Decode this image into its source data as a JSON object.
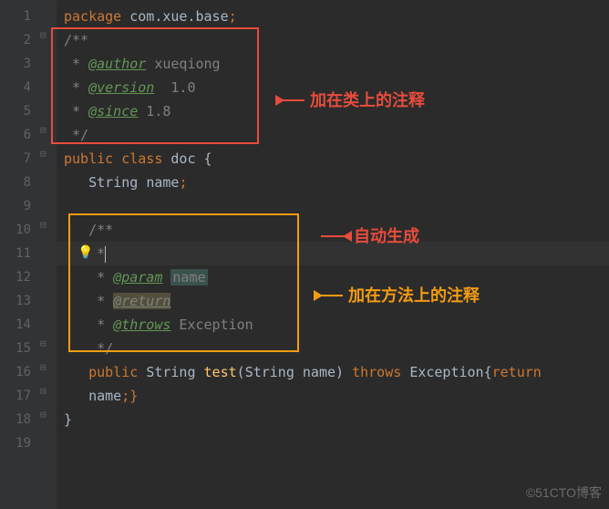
{
  "lines": [
    "1",
    "2",
    "3",
    "4",
    "5",
    "6",
    "7",
    "8",
    "9",
    "10",
    "11",
    "12",
    "13",
    "14",
    "15",
    "16",
    "17",
    "18",
    "19"
  ],
  "code": {
    "l1": {
      "kw": "package",
      "pkg": " com.xue.base"
    },
    "l2": {
      "cmt": "/**"
    },
    "l3": {
      "pre": " * ",
      "tag": "@author",
      "after": " xueqiong"
    },
    "l4": {
      "pre": " * ",
      "tag": "@version",
      "after": "  1.0"
    },
    "l5": {
      "pre": " * ",
      "tag": "@since",
      "after": " 1.8"
    },
    "l6": {
      "cmt": " */"
    },
    "l7": {
      "kw1": "public",
      "kw2": " class ",
      "cls": "doc",
      "brace": " {"
    },
    "l8": {
      "type": "String ",
      "name": "name"
    },
    "l10": {
      "cmt": "/**"
    },
    "l11": {
      "pre": " *"
    },
    "l12": {
      "pre": " * ",
      "tag": "@param",
      "paramname": "name"
    },
    "l13": {
      "pre": " * ",
      "tag": "@return"
    },
    "l14": {
      "pre": " * ",
      "tag": "@throws",
      "after": " Exception"
    },
    "l15": {
      "cmt": " */"
    },
    "l16": {
      "kw1": "public ",
      "type": "String ",
      "method": "test",
      "paren1": "(",
      "ptype": "String ",
      "pname": "name",
      "paren2": ") ",
      "kw2": "throws ",
      "exc": "Exception",
      "brace": "{",
      "kw3": "return"
    },
    "l17": {
      "name": "name",
      "brace": ";}"
    },
    "l18": {
      "brace": "}"
    }
  },
  "annotations": {
    "classComment": "加在类上的注释",
    "autoGen": "自动生成",
    "methodComment": "加在方法上的注释"
  },
  "watermark": "©51CTO博客"
}
